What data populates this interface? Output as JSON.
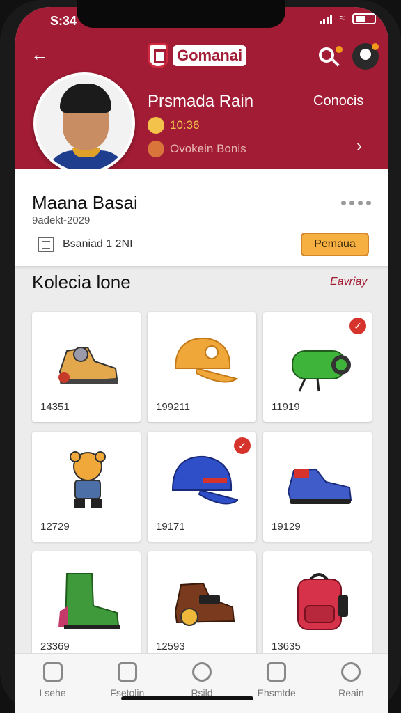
{
  "status_bar": {
    "time": "S:34"
  },
  "header": {
    "brand": "Gomanai",
    "name": "Prsmada Rain",
    "right_link": "Conocis",
    "time_line": "10:36",
    "location_line": "Ovokein Bonis"
  },
  "profile": {
    "name": "Maana Basai",
    "subtitle": "9adekt-2029",
    "doc_label": "Bsaniad 1 2NI",
    "action_button": "Pemaua"
  },
  "collection": {
    "title": "Kolecia lone",
    "link": "Eavriay",
    "items": [
      {
        "number": "14351",
        "icon": "sneaker-icon",
        "checked": false
      },
      {
        "number": "199211",
        "icon": "cap-icon",
        "checked": false
      },
      {
        "number": "11919",
        "icon": "water-bottle-icon",
        "checked": true
      },
      {
        "number": "12729",
        "icon": "toy-figure-icon",
        "checked": false
      },
      {
        "number": "19171",
        "icon": "cap-icon",
        "checked": true
      },
      {
        "number": "19129",
        "icon": "shoe-icon",
        "checked": false
      },
      {
        "number": "23369",
        "icon": "boot-icon",
        "checked": false
      },
      {
        "number": "12593",
        "icon": "shoe-icon",
        "checked": false
      },
      {
        "number": "13635",
        "icon": "backpack-icon",
        "checked": false
      }
    ]
  },
  "bottom_nav": [
    {
      "label": "Lsehe",
      "icon": "home-icon"
    },
    {
      "label": "Fsetolin",
      "icon": "edit-icon"
    },
    {
      "label": "Rsild",
      "icon": "compass-icon"
    },
    {
      "label": "Ehsmtde",
      "icon": "map-icon"
    },
    {
      "label": "Reain",
      "icon": "user-icon"
    }
  ],
  "colors": {
    "header_bg": "#a11c34",
    "accent": "#f6b042",
    "check": "#d6332c"
  }
}
